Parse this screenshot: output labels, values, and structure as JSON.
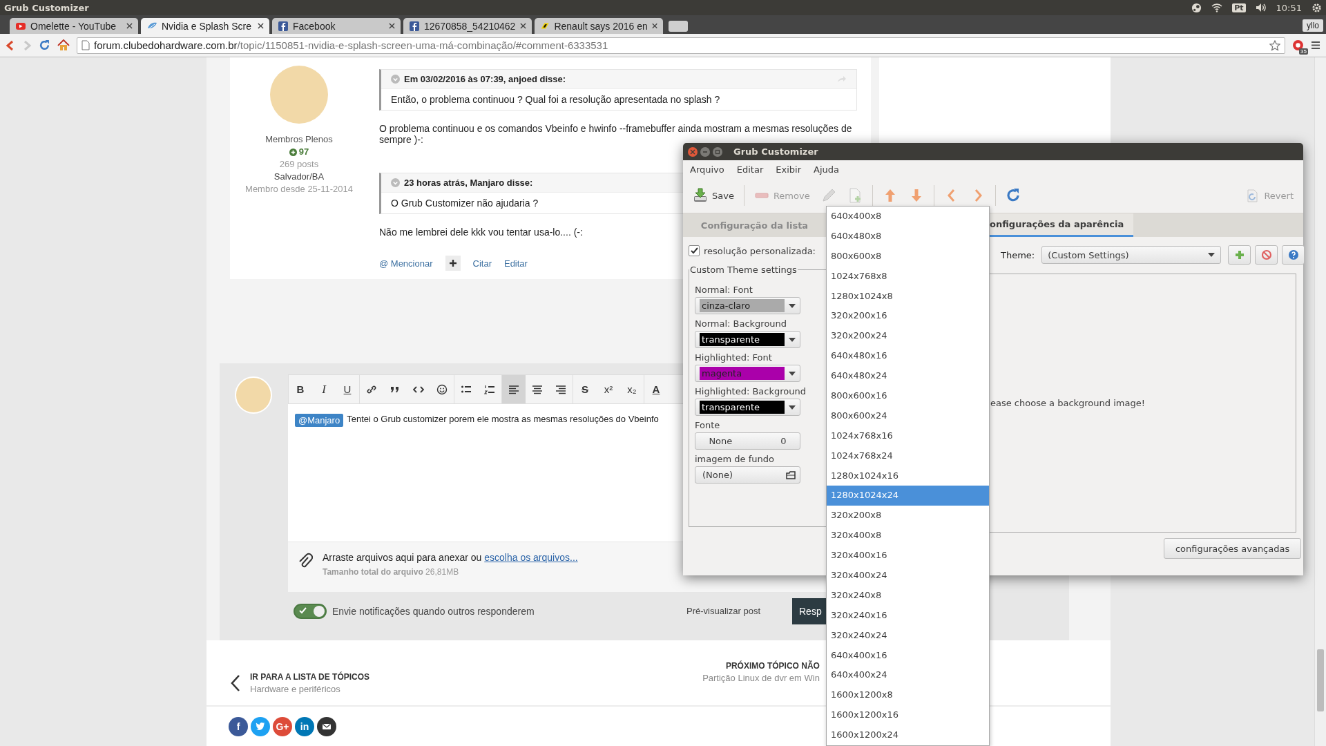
{
  "desktop_panel": {
    "app_title": "Grub Customizer",
    "keyboard": "Pt",
    "clock": "10:51"
  },
  "browser": {
    "tabs": [
      {
        "title": "Omelette - YouTube",
        "kind": "video",
        "selected": false
      },
      {
        "title": "Nvidia e Splash Scre",
        "kind": "forum",
        "selected": true
      },
      {
        "title": "Facebook",
        "kind": "social",
        "selected": false
      },
      {
        "title": "12670858_54210462",
        "kind": "social",
        "selected": false
      },
      {
        "title": "Renault says 2016 en",
        "kind": "news",
        "selected": false
      }
    ],
    "profile": "yllo",
    "url_domain": "forum.clubedohardware.com.br",
    "url_path": "/topic/1150851-nvidia-e-splash-screen-uma-má-combinação/#comment-6333531",
    "extension_badge": "35"
  },
  "post": {
    "author": {
      "group": "Membros Plenos",
      "reputation": "97",
      "posts": "269 posts",
      "location": "Salvador/BA",
      "member_since": "Membro desde 25-11-2014"
    },
    "blocks": [
      {
        "kind": "quote",
        "header": "Em 03/02/2016 às 07:39, anjoed disse:",
        "text": "Então, o problema continuou ? Qual foi a resolução apresentada no splash ?"
      },
      {
        "kind": "text",
        "text": "O problema continuou e os comandos Vbeinfo e hwinfo --framebuffer ainda mostram a mesmas resoluções de sempre )-:"
      },
      {
        "kind": "quote",
        "header": "23 horas atrás, Manjaro disse:",
        "text": "O Grub Customizer não ajudaria ?"
      },
      {
        "kind": "text",
        "text": "Não me lembrei dele kkk vou tentar usa-lo.... (-:"
      }
    ],
    "actions": {
      "mention": "@ Mencionar",
      "quote": "Citar",
      "edit": "Editar"
    }
  },
  "editor": {
    "toolbar": [
      {
        "kind": "bold",
        "glyph": "B",
        "selected": false
      },
      {
        "kind": "italic",
        "glyph": "I",
        "selected": false
      },
      {
        "kind": "underline",
        "glyph": "U",
        "selected": false
      },
      {
        "kind": "link",
        "selected": false
      },
      {
        "kind": "quote",
        "selected": false
      },
      {
        "kind": "code",
        "selected": false
      },
      {
        "kind": "emoji",
        "selected": false
      },
      {
        "kind": "bullets",
        "selected": false
      },
      {
        "kind": "numbers",
        "selected": false
      },
      {
        "kind": "align-left",
        "selected": true
      },
      {
        "kind": "align-center",
        "selected": false
      },
      {
        "kind": "align-right",
        "selected": false
      },
      {
        "kind": "strike",
        "glyph": "S",
        "selected": false
      },
      {
        "kind": "superscript",
        "glyph": "x²",
        "selected": false
      },
      {
        "kind": "subscript",
        "glyph": "x₂",
        "selected": false
      },
      {
        "kind": "text-color",
        "glyph": "A",
        "selected": false
      }
    ],
    "mention": "@Manjaro",
    "text": "Tentei o Grub customizer porem ele mostra as mesmas resoluções do Vbeinfo",
    "attach_text": "Arraste arquivos aqui para anexar ou ",
    "attach_link": "escolha os arquivos...",
    "size_text": "**Tamanho total do arquivo** 26,81MB",
    "notify": {
      "label": "Envie notificações quando outros responderem",
      "on": true
    },
    "preview_button": "Pré-visualizar post",
    "submit_button": "Resp"
  },
  "topic_nav": {
    "prev_title": "IR PARA A LISTA DE TÓPICOS",
    "prev_sub": "Hardware e periféricos",
    "next_title": "PRÓXIMO TÓPICO NÃO",
    "next_sub": "Partição Linux de dvr em Win"
  },
  "share": [
    {
      "kind": "facebook",
      "glyph": "f"
    },
    {
      "kind": "twitter"
    },
    {
      "kind": "googleplus",
      "glyph": "G+"
    },
    {
      "kind": "linkedin",
      "glyph": "in"
    },
    {
      "kind": "email"
    }
  ],
  "grub_window": {
    "title": "Grub Customizer",
    "menu": [
      "Arquivo",
      "Editar",
      "Exibir",
      "Ajuda"
    ],
    "toolbar": [
      {
        "kind": "save",
        "label": "Save",
        "disabled": false
      },
      {
        "kind": "remove",
        "label": "Remove",
        "disabled": true
      },
      {
        "kind": "edit",
        "disabled": true
      },
      {
        "kind": "new",
        "disabled": true
      },
      {
        "kind": "up",
        "disabled": false
      },
      {
        "kind": "down",
        "disabled": false
      },
      {
        "kind": "left",
        "disabled": false
      },
      {
        "kind": "right",
        "disabled": false
      },
      {
        "kind": "refresh",
        "disabled": false
      },
      {
        "kind": "revert",
        "label": "Revert",
        "disabled": true
      }
    ],
    "tabs": [
      {
        "label": "Configuração da lista",
        "selected": false
      },
      {
        "label": "onfigurações da aparência",
        "selected": true
      }
    ],
    "custom_resolution": {
      "label": "resolução personalizada:",
      "checked": true
    },
    "theme_settings": {
      "legend": "Custom Theme settings",
      "fields": [
        {
          "kind": "color",
          "label": "Normal: Font",
          "value": "cinza-claro",
          "color": "#aaaaaa"
        },
        {
          "kind": "color",
          "label": "Normal: Background",
          "value": "transparente",
          "color": "#000000"
        },
        {
          "kind": "color",
          "label": "Highlighted: Font",
          "value": "magenta",
          "color": "#aa00aa"
        },
        {
          "kind": "color",
          "label": "Highlighted: Background",
          "value": "transparente",
          "color": "#000000"
        },
        {
          "kind": "font",
          "label": "Fonte",
          "value": "None",
          "size": "0"
        },
        {
          "kind": "file",
          "label": "imagem de fundo",
          "value": "(None)"
        }
      ]
    },
    "theme": {
      "label": "Theme:",
      "value": "(Custom Settings)",
      "buttons": [
        {
          "kind": "add"
        },
        {
          "kind": "remove"
        },
        {
          "kind": "help"
        }
      ]
    },
    "preview_message": "ease choose a background image!",
    "advanced_button": "configurações avançadas"
  },
  "resolution_dropdown": {
    "items": [
      {
        "label": "640x400x8",
        "selected": false
      },
      {
        "label": "640x480x8",
        "selected": false
      },
      {
        "label": "800x600x8",
        "selected": false
      },
      {
        "label": "1024x768x8",
        "selected": false
      },
      {
        "label": "1280x1024x8",
        "selected": false
      },
      {
        "label": "320x200x16",
        "selected": false
      },
      {
        "label": "320x200x24",
        "selected": false
      },
      {
        "label": "640x480x16",
        "selected": false
      },
      {
        "label": "640x480x24",
        "selected": false
      },
      {
        "label": "800x600x16",
        "selected": false
      },
      {
        "label": "800x600x24",
        "selected": false
      },
      {
        "label": "1024x768x16",
        "selected": false
      },
      {
        "label": "1024x768x24",
        "selected": false
      },
      {
        "label": "1280x1024x16",
        "selected": false
      },
      {
        "label": "1280x1024x24",
        "selected": true
      },
      {
        "label": "320x200x8",
        "selected": false
      },
      {
        "label": "320x400x8",
        "selected": false
      },
      {
        "label": "320x400x16",
        "selected": false
      },
      {
        "label": "320x400x24",
        "selected": false
      },
      {
        "label": "320x240x8",
        "selected": false
      },
      {
        "label": "320x240x16",
        "selected": false
      },
      {
        "label": "320x240x24",
        "selected": false
      },
      {
        "label": "640x400x16",
        "selected": false
      },
      {
        "label": "640x400x24",
        "selected": false
      },
      {
        "label": "1600x1200x8",
        "selected": false
      },
      {
        "label": "1600x1200x16",
        "selected": false
      },
      {
        "label": "1600x1200x24",
        "selected": false
      }
    ]
  }
}
